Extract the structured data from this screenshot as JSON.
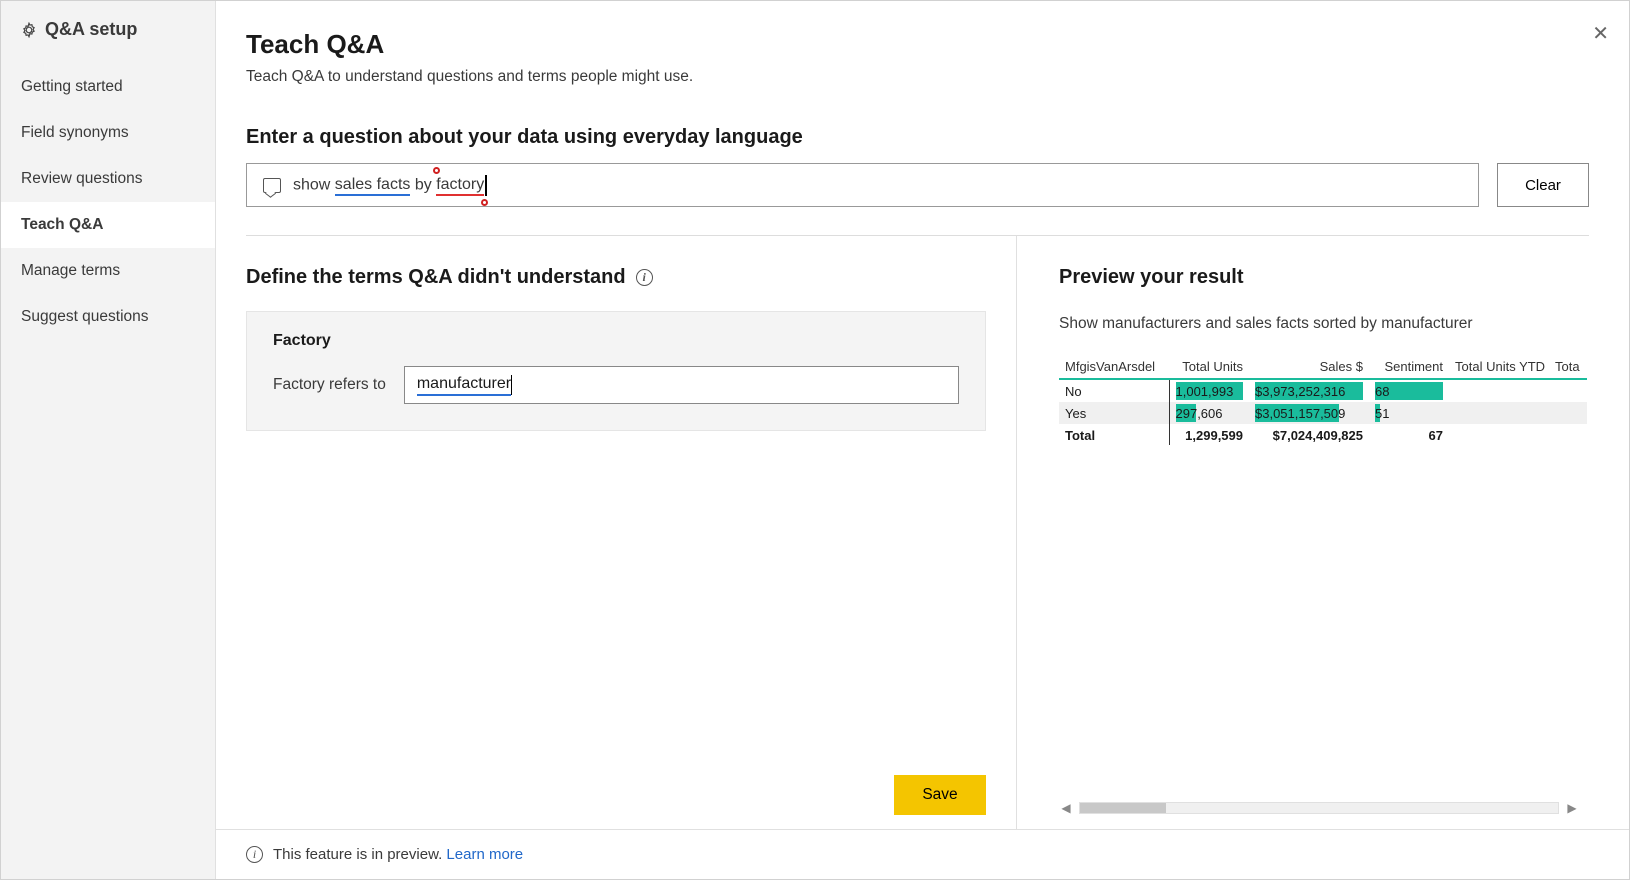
{
  "sidebar": {
    "title": "Q&A setup",
    "items": [
      {
        "label": "Getting started",
        "active": false
      },
      {
        "label": "Field synonyms",
        "active": false
      },
      {
        "label": "Review questions",
        "active": false
      },
      {
        "label": "Teach Q&A",
        "active": true
      },
      {
        "label": "Manage terms",
        "active": false
      },
      {
        "label": "Suggest questions",
        "active": false
      }
    ]
  },
  "page": {
    "title": "Teach Q&A",
    "subtitle": "Teach Q&A to understand questions and terms people might use."
  },
  "question": {
    "label": "Enter a question about your data using everyday language",
    "prefix": "show ",
    "underlined1": "sales facts",
    "middle": " by ",
    "underlined_red": "factory",
    "clear_button": "Clear"
  },
  "define": {
    "heading": "Define the terms Q&A didn't understand",
    "term_name": "Factory",
    "refers_label": "Factory refers to",
    "refers_value": "manufacturer",
    "save_button": "Save"
  },
  "preview": {
    "heading": "Preview your result",
    "description": "Show manufacturers and sales facts sorted by manufacturer",
    "columns": [
      "MfgisVanArsdel",
      "Total Units",
      "Sales $",
      "Sentiment",
      "Total Units YTD",
      "Tota"
    ],
    "rows": [
      {
        "c0": "No",
        "c1": "1,001,993",
        "c2": "$3,973,252,316",
        "c3": "68",
        "b1": 100,
        "b2": 100,
        "b3": 100
      },
      {
        "c0": "Yes",
        "c1": "297,606",
        "c2": "$3,051,157,509",
        "c3": "51",
        "b1": 30,
        "b2": 78,
        "b3": 8
      }
    ],
    "total": {
      "c0": "Total",
      "c1": "1,299,599",
      "c2": "$7,024,409,825",
      "c3": "67"
    }
  },
  "footer": {
    "text": "This feature is in preview.",
    "link": "Learn more"
  }
}
